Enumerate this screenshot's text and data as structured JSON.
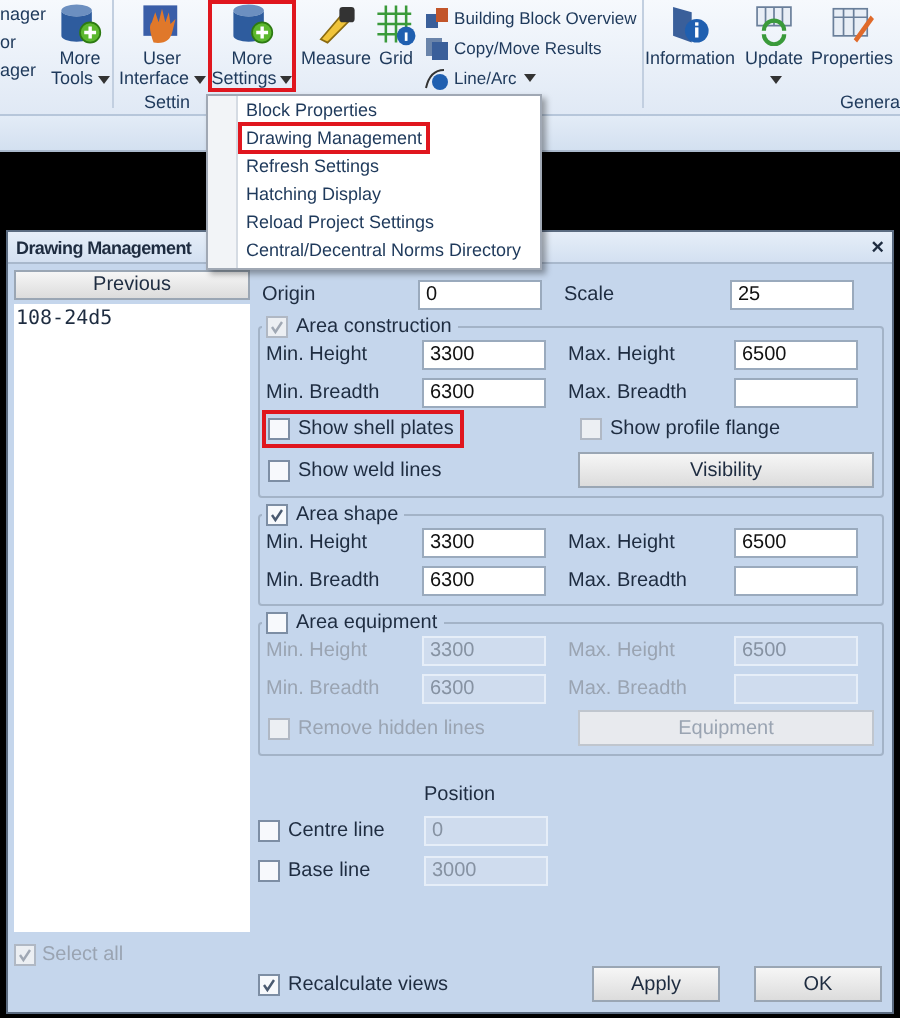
{
  "ribbon": {
    "cut_labels": [
      "nager",
      "or",
      "ager"
    ],
    "buttons": [
      {
        "label": "More Tools",
        "dropdown": true,
        "highlighted": false
      },
      {
        "label": "User Interface",
        "dropdown": true,
        "highlighted": false
      },
      {
        "label": "More Settings",
        "dropdown": true,
        "highlighted": true
      },
      {
        "label": "Measure",
        "dropdown": false,
        "highlighted": false
      },
      {
        "label": "Grid",
        "dropdown": false,
        "highlighted": false
      }
    ],
    "small_buttons": [
      {
        "label": "Building Block Overview",
        "dropdown": false
      },
      {
        "label": "Copy/Move Results",
        "dropdown": false
      },
      {
        "label": "Line/Arc",
        "dropdown": true
      }
    ],
    "right_buttons": [
      {
        "label": "Information",
        "dropdown": false
      },
      {
        "label": "Update",
        "dropdown": true
      },
      {
        "label": "Properties",
        "dropdown": false
      }
    ],
    "group_labels": [
      "Settin",
      "Genera"
    ]
  },
  "menu": {
    "items": [
      {
        "label": "Block Properties",
        "highlighted": false
      },
      {
        "label": "Drawing Management",
        "highlighted": true
      },
      {
        "label": "Refresh Settings",
        "highlighted": false
      },
      {
        "label": "Hatching Display",
        "highlighted": false
      },
      {
        "label": "Reload Project Settings",
        "highlighted": false
      },
      {
        "label": "Central/Decentral Norms Directory",
        "highlighted": false
      }
    ]
  },
  "dialog": {
    "title": "Drawing Management",
    "close": "×",
    "previous_button": "Previous",
    "list_items": [
      "108-24d5"
    ],
    "select_all": {
      "label": "Select all",
      "checked": true,
      "disabled": true
    },
    "origin": {
      "label": "Origin",
      "value": "0"
    },
    "scale": {
      "label": "Scale",
      "value": "25"
    },
    "groups": [
      {
        "title": "Area construction",
        "checked": true,
        "disabled": true,
        "fields_disabled": false,
        "fields": [
          {
            "label": "Min. Height",
            "value": "3300"
          },
          {
            "label": "Max. Height",
            "value": "6500"
          },
          {
            "label": "Min. Breadth",
            "value": "6300"
          },
          {
            "label": "Max. Breadth"
          }
        ],
        "options": [
          {
            "kind": "checkbox",
            "label": "Show shell plates",
            "checked": false,
            "disabled": false,
            "highlighted": true
          },
          {
            "kind": "checkbox",
            "label": "Show profile flange",
            "checked": false,
            "disabled": true,
            "highlighted": false
          },
          {
            "kind": "checkbox",
            "label": "Show weld lines",
            "checked": false,
            "disabled": false,
            "highlighted": false
          },
          {
            "kind": "button",
            "label": "Visibility",
            "disabled": false
          }
        ]
      },
      {
        "title": "Area shape",
        "checked": true,
        "disabled": false,
        "fields_disabled": false,
        "fields": [
          {
            "label": "Min. Height",
            "value": "3300"
          },
          {
            "label": "Max. Height",
            "value": "6500"
          },
          {
            "label": "Min. Breadth",
            "value": "6300"
          },
          {
            "label": "Max. Breadth"
          }
        ]
      },
      {
        "title": "Area equipment",
        "checked": false,
        "disabled": false,
        "fields_disabled": true,
        "fields": [
          {
            "label": "Min. Height",
            "value": "3300"
          },
          {
            "label": "Max. Height",
            "value": "6500"
          },
          {
            "label": "Min. Breadth",
            "value": "6300"
          },
          {
            "label": "Max. Breadth"
          }
        ],
        "options": [
          {
            "kind": "checkbox",
            "label": "Remove hidden lines",
            "checked": false,
            "disabled": true,
            "highlighted": false
          },
          {
            "kind": "button",
            "label": "Equipment",
            "disabled": true
          }
        ]
      }
    ],
    "position_label": "Position",
    "position_rows": [
      {
        "label": "Centre line",
        "checked": false,
        "value": "0",
        "field_disabled": true
      },
      {
        "label": "Base line",
        "checked": false,
        "value": "3000",
        "field_disabled": true
      }
    ],
    "recalculate": {
      "label": "Recalculate views",
      "checked": true
    },
    "buttons": [
      "Apply",
      "OK"
    ]
  }
}
